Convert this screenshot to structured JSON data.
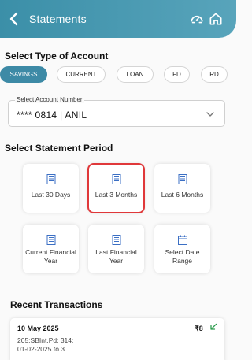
{
  "header": {
    "title": "Statements",
    "back_icon": "arrow-left-icon",
    "speedometer_icon": "speedometer-icon",
    "home_icon": "home-icon",
    "colors": {
      "gradient_start": "#3b8fa8",
      "gradient_end": "#58a4bb"
    }
  },
  "account_type": {
    "title": "Select Type of Account",
    "options": [
      "SAVINGS",
      "CURRENT",
      "LOAN",
      "FD",
      "RD"
    ],
    "selected": "SAVINGS",
    "active_color": "#3d8aa6"
  },
  "account_number": {
    "label": "Select Account Number",
    "value": "**** 0814 | ANIL",
    "icon": "chevron-down-icon"
  },
  "statement_period": {
    "title": "Select Statement Period",
    "options": [
      {
        "label": "Last 30 Days",
        "icon": "document-icon"
      },
      {
        "label": "Last 3 Months",
        "icon": "document-icon",
        "highlighted": true
      },
      {
        "label": "Last 6 Months",
        "icon": "document-icon"
      },
      {
        "label": "Current Financial Year",
        "icon": "document-icon"
      },
      {
        "label": "Last Financial Year",
        "icon": "document-icon"
      },
      {
        "label": "Select Date Range",
        "icon": "calendar-icon"
      }
    ],
    "highlight_color": "#e0383a"
  },
  "recent_transactions": {
    "title": "Recent Transactions",
    "items": [
      {
        "date": "10 May 2025",
        "amount": "₹8",
        "direction_icon": "arrow-down-left-icon",
        "description": "205:SBInt.Pd: 314:\n01-02-2025 to 3"
      }
    ]
  }
}
